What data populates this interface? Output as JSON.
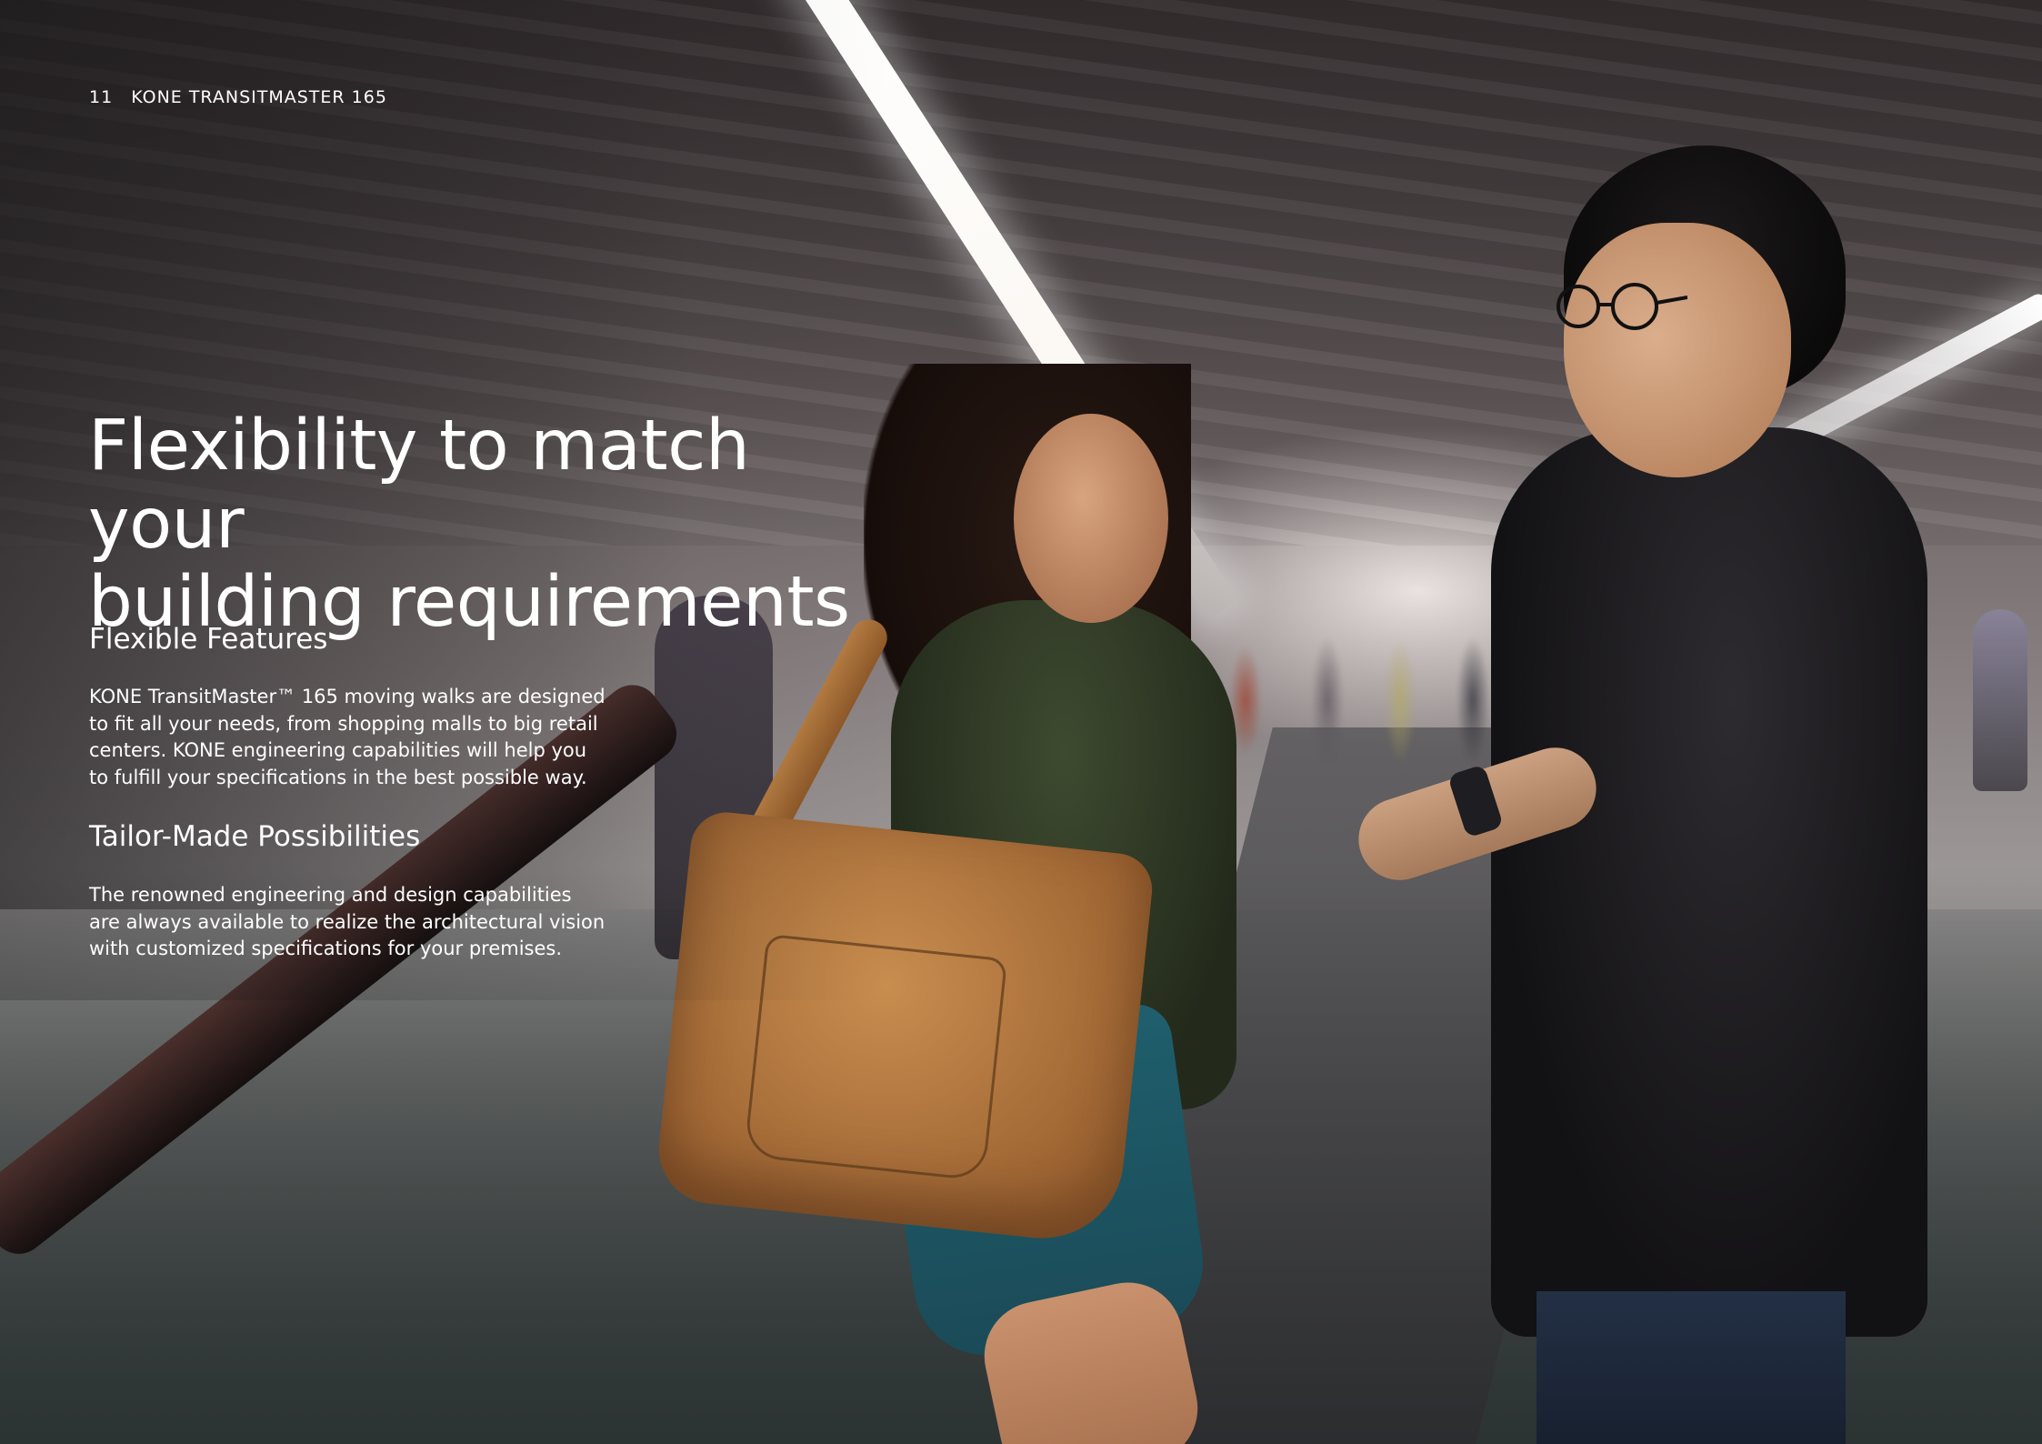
{
  "header": {
    "page_number": "11",
    "product_name": "KONE TRANSITMASTER 165"
  },
  "title": {
    "line1": "Flexibility to match your",
    "line2": "building requirements"
  },
  "sections": [
    {
      "heading": "Flexible Features",
      "body": "KONE TransitMaster™ 165 moving walks are designed to fit all your needs, from shopping malls to big retail centers. KONE engineering capabilities will help you to fulfill your specifications in the best possible way."
    },
    {
      "heading": "Tailor-Made Possibilities",
      "body": "The renowned engineering and design capabilities are always available to realize the architectural vision with customized specifications for your premises."
    }
  ],
  "colors": {
    "text": "#ffffff"
  }
}
